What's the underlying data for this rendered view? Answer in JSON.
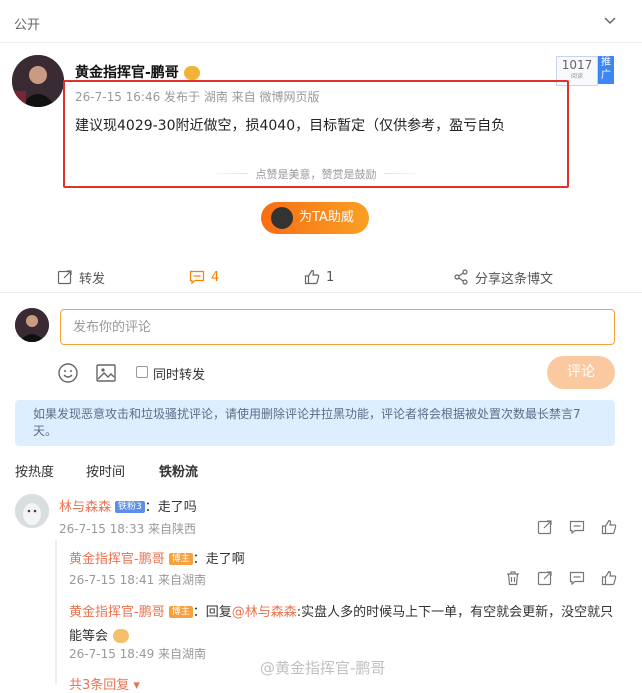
{
  "header": {
    "visibility": "公开"
  },
  "post": {
    "author": "黄金指挥官-鹏哥",
    "meta": "26-7-15 16:46  发布于 湖南  来自 微博网页版",
    "text": "建议现4029-30附近做空，损4040，目标暂定（仅供参考，盈亏自负",
    "like_hint": "点赞是美意，赞赏是鼓励",
    "support_label": "为TA助威",
    "badge_count": "1017",
    "badge_sub": "阅读",
    "badge_tag": "推广"
  },
  "actions": {
    "forward_label": "转发",
    "comment_count": "4",
    "like_count": "1",
    "share_label": "分享这条博文"
  },
  "composer": {
    "placeholder": "发布你的评论",
    "also_forward_label": "同时转发",
    "submit_label": "评论"
  },
  "notice": "如果发现恶意攻击和垃圾骚扰评论，请使用删除评论并拉黑功能，评论者将会根据被处置次数最长禁言7天。",
  "sort_tabs": [
    "按热度",
    "按时间",
    "铁粉流"
  ],
  "comments": [
    {
      "user": "林与森森",
      "tag": "铁粉3",
      "text": "：走了吗",
      "time": "26-7-15 18:33 来自陕西"
    },
    {
      "user": "黄金指挥官-鹏哥",
      "tag": "博主",
      "text": "：走了啊",
      "time": "26-7-15 18:41 来自湖南"
    },
    {
      "user": "黄金指挥官-鹏哥",
      "tag": "博主",
      "text_prefix": "：回复",
      "mention": "@林与森森",
      "text": ":实盘人多的时候马上下一单，有空就会更新，没空就只",
      "text_line2": "能等会",
      "time": "26-7-15 18:49 来自湖南"
    }
  ],
  "more_replies": "共3条回复",
  "watermark": "@黄金指挥官-鹏哥",
  "colors": {
    "accent": "#f78200",
    "link": "#eb7350",
    "highlight_box": "#e0322b",
    "notice_bg": "#ddeeff"
  }
}
